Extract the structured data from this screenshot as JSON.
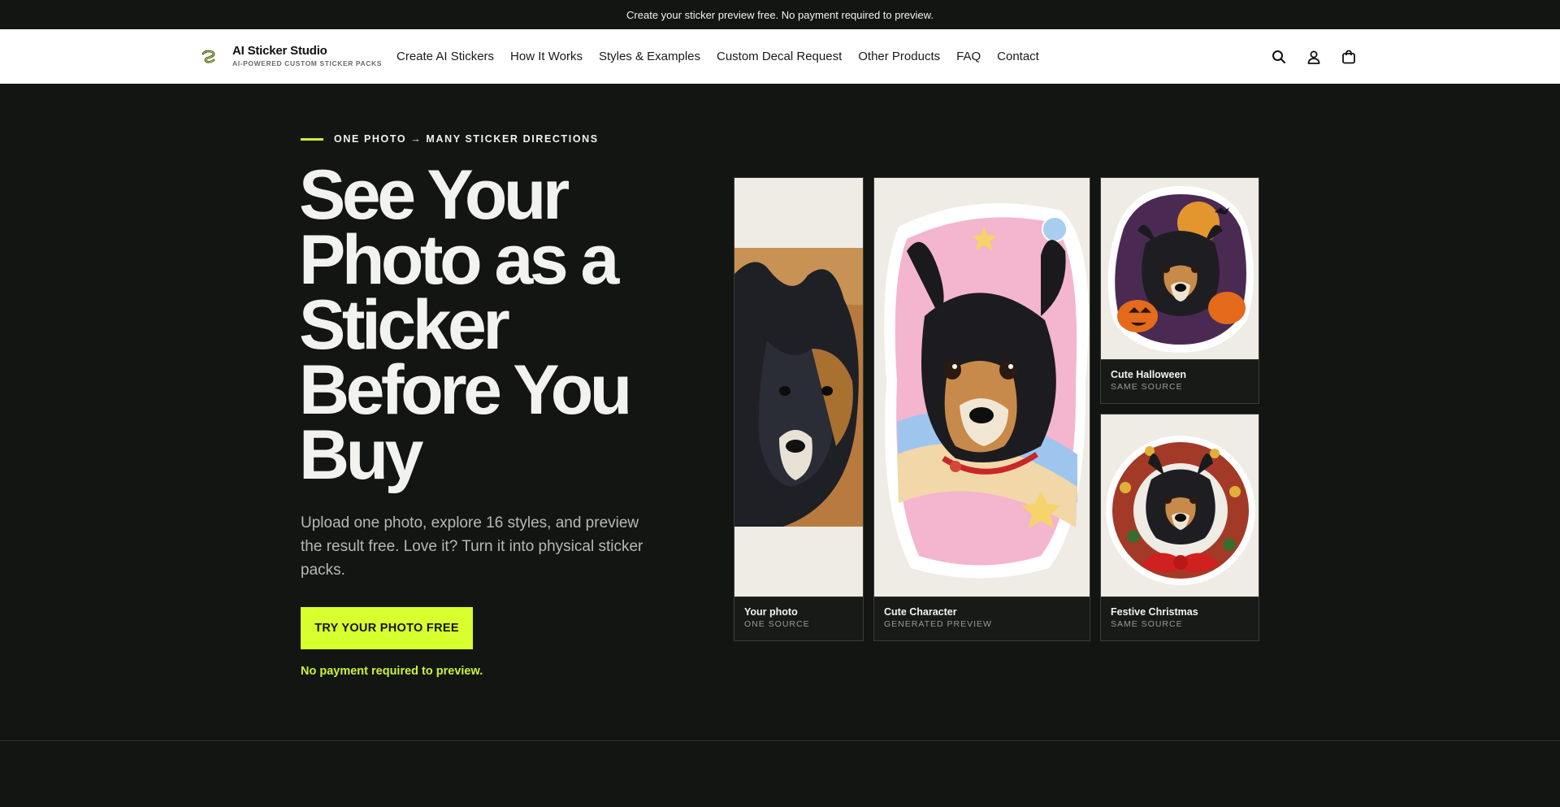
{
  "announcement": "Create your sticker preview free. No payment required to preview.",
  "brand": {
    "name": "AI Sticker Studio",
    "tagline": "AI-POWERED CUSTOM STICKER PACKS"
  },
  "nav": [
    "Create AI Stickers",
    "How It Works",
    "Styles & Examples",
    "Custom Decal Request",
    "Other Products",
    "FAQ",
    "Contact"
  ],
  "header_icons": [
    "search-icon",
    "account-icon",
    "cart-icon"
  ],
  "hero": {
    "eyebrow": "ONE PHOTO → MANY STICKER DIRECTIONS",
    "title": "See Your Photo as a Sticker Before You Buy",
    "subtitle": "Upload one photo, explore 16 styles, and preview the result free. Love it? Turn it into physical sticker packs.",
    "cta": "TRY YOUR PHOTO FREE",
    "note": "No payment required to preview."
  },
  "cards": [
    {
      "title": "Your photo",
      "subtitle": "ONE SOURCE"
    },
    {
      "title": "Cute Character",
      "subtitle": "GENERATED PREVIEW"
    },
    {
      "title": "Cute Halloween",
      "subtitle": "SAME SOURCE"
    },
    {
      "title": "Festive Christmas",
      "subtitle": "SAME SOURCE"
    }
  ],
  "colors": {
    "accent": "#d8ff2e",
    "background": "#131512",
    "header": "#ffffff"
  }
}
